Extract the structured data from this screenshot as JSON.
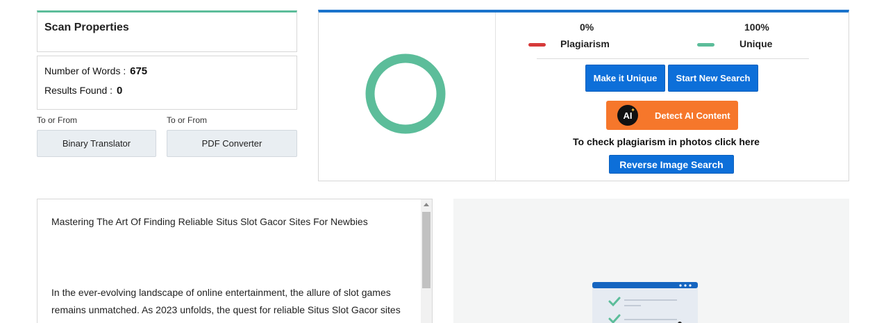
{
  "scan": {
    "title": "Scan Properties",
    "words_label": "Number of Words :",
    "words_value": "675",
    "results_label": "Results Found :",
    "results_value": "0"
  },
  "tools": [
    {
      "label": "To or From",
      "button": "Binary Translator"
    },
    {
      "label": "To or From",
      "button": "PDF Converter"
    }
  ],
  "results": {
    "plagiarism_pct": "0%",
    "unique_pct": "100%",
    "plagiarism_label": "Plagiarism",
    "unique_label": "Unique",
    "plagiarism_value": 0,
    "unique_value": 100,
    "colors": {
      "plagiarism": "#d63a3a",
      "unique": "#5cbd9a"
    },
    "make_unique_button": "Make it Unique",
    "new_search_button": "Start New Search",
    "detect_ai_button": "Detect AI Content",
    "ai_badge": "AI",
    "photo_text": "To check plagiarism in photos click here",
    "reverse_image_button": "Reverse Image Search"
  },
  "content": {
    "title": "Mastering The Art Of Finding Reliable Situs Slot Gacor Sites For Newbies",
    "body": "In the ever-evolving landscape of online entertainment, the allure of slot games remains unmatched. As 2023 unfolds, the quest for reliable Situs Slot Gacor sites continues to be a priority for both seasoned players and"
  },
  "icons": {
    "ai": "ai-badge-icon",
    "checklist": "checklist-document-icon"
  }
}
